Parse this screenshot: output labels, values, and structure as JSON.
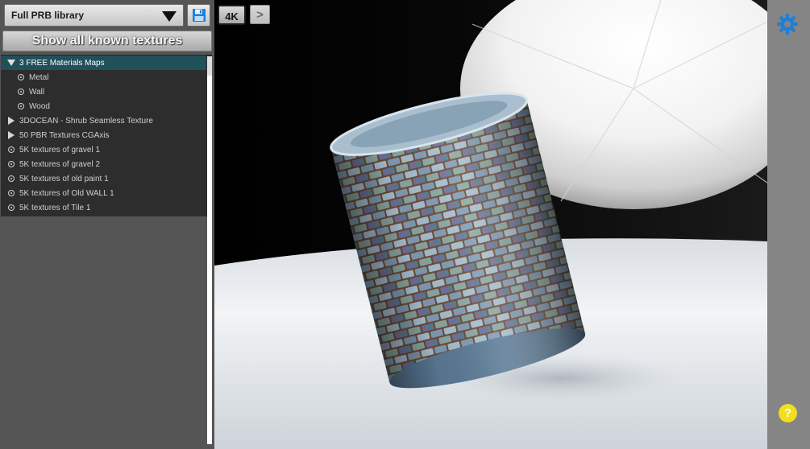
{
  "library": {
    "selected": "Full PRB library",
    "show_all_label": "Show all known textures"
  },
  "tree": {
    "items": [
      {
        "label": "3 FREE Materials Maps",
        "type": "expanded",
        "selected": true,
        "indent": 0
      },
      {
        "label": "Metal",
        "type": "leaf",
        "selected": false,
        "indent": 1
      },
      {
        "label": "Wall",
        "type": "leaf",
        "selected": false,
        "indent": 1
      },
      {
        "label": "Wood",
        "type": "leaf",
        "selected": false,
        "indent": 1
      },
      {
        "label": "3DOCEAN - Shrub Seamless Texture",
        "type": "collapsed",
        "selected": false,
        "indent": 0
      },
      {
        "label": "50 PBR Textures CGAxis",
        "type": "collapsed",
        "selected": false,
        "indent": 0
      },
      {
        "label": "5K textures of gravel 1",
        "type": "leaf",
        "selected": false,
        "indent": 0
      },
      {
        "label": "5K textures of gravel 2",
        "type": "leaf",
        "selected": false,
        "indent": 0
      },
      {
        "label": "5K textures of old paint 1",
        "type": "leaf",
        "selected": false,
        "indent": 0
      },
      {
        "label": "5K textures of Old WALL 1",
        "type": "leaf",
        "selected": false,
        "indent": 0
      },
      {
        "label": "5K textures of Tile 1",
        "type": "leaf",
        "selected": false,
        "indent": 0
      }
    ]
  },
  "viewport": {
    "resolution_label": "4K",
    "next_label": ">"
  },
  "help": {
    "label": "?"
  },
  "icons": {
    "dropdown": "chevron-down-icon",
    "save": "floppy-disk-icon",
    "settings": "gear-icon",
    "help": "help-icon"
  },
  "colors": {
    "selection": "#20505a",
    "accent_blue": "#1e7fd6",
    "help_yellow": "#f2de1e"
  }
}
